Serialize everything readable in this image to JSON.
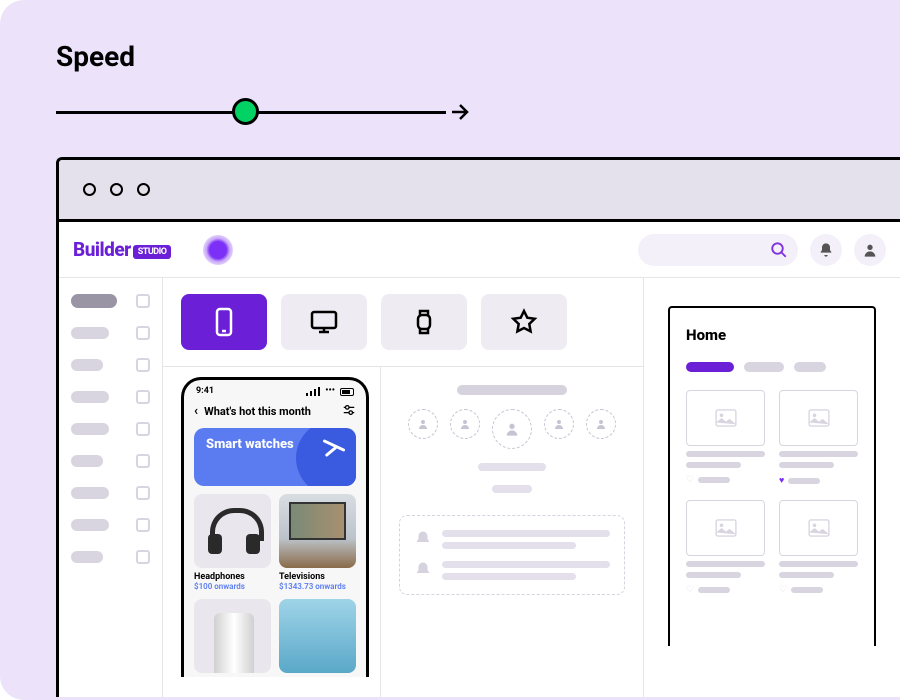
{
  "section_title": "Speed",
  "brand": {
    "name": "Builder",
    "badge": "STUDIO"
  },
  "phone": {
    "time": "9:41",
    "header": "What's hot this month",
    "banner_title": "Smart watches",
    "products": [
      {
        "name": "Headphones",
        "price": "$100 onwards"
      },
      {
        "name": "Televisions",
        "price": "$1343.73 onwards"
      }
    ]
  },
  "right": {
    "title": "Home"
  },
  "colors": {
    "accent": "#6b1fd6",
    "slider_thumb": "#00d264",
    "banner": "#5a7cf0"
  }
}
